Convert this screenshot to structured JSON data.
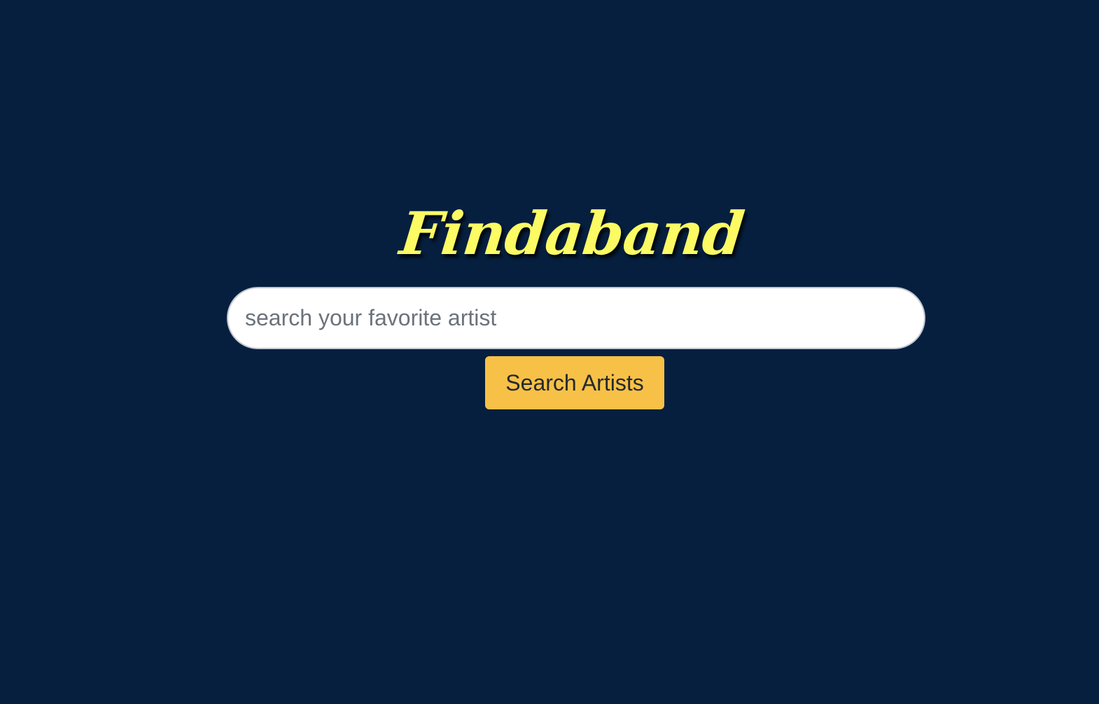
{
  "app": {
    "title": "Findaband"
  },
  "search": {
    "placeholder": "search your favorite artist",
    "value": "",
    "button_label": "Search Artists"
  },
  "colors": {
    "background": "#061f3f",
    "title": "#fcfb64",
    "button": "#f7c147"
  }
}
